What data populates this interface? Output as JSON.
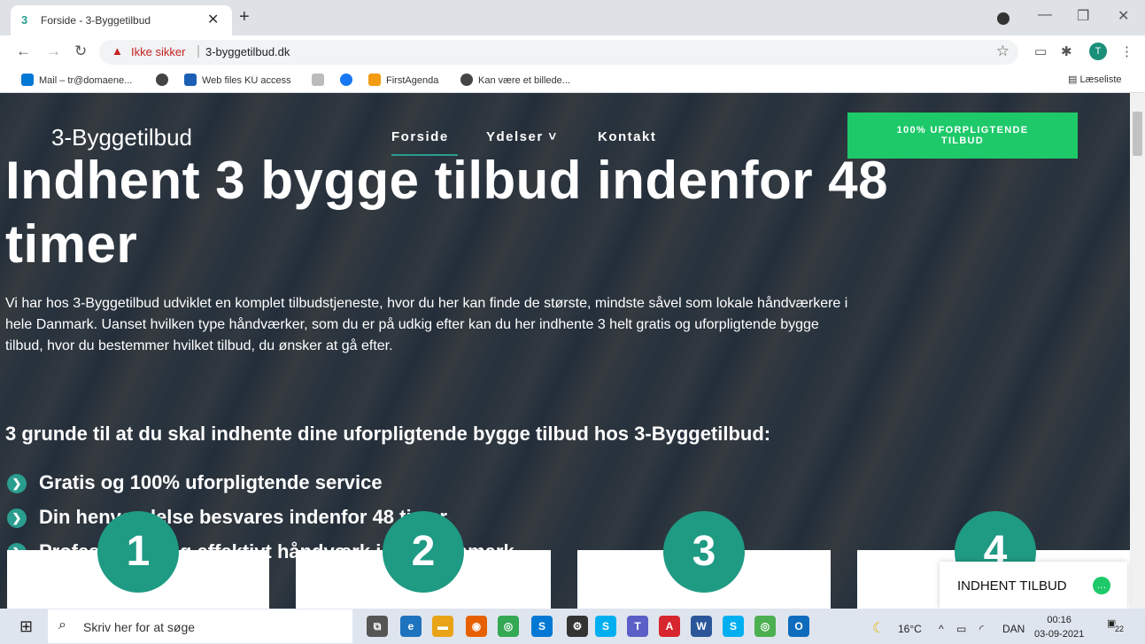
{
  "browser": {
    "tab_favicon": "3",
    "tab_title": "Forside - 3-Byggetilbud",
    "tab_close": "✕",
    "new_tab": "+",
    "security_label": "Ikke sikker",
    "url": "3-byggetilbud.dk",
    "bookmarks": [
      {
        "label": "Mail – tr@domaene...",
        "color": "#0078d4"
      },
      {
        "label": "",
        "color": "#444444"
      },
      {
        "label": "Web files KU access",
        "color": "#1a5fb4"
      },
      {
        "label": "",
        "color": "#888888"
      },
      {
        "label": "",
        "color": "#1877f2"
      },
      {
        "label": "FirstAgenda",
        "color": "#f39c12"
      },
      {
        "label": "Kan være et billede...",
        "color": "#444444"
      }
    ],
    "reading_list": "Læseliste",
    "avatar_letter": "T"
  },
  "site": {
    "logo": "3-Byggetilbud",
    "nav": [
      "Forside",
      "Ydelser ˅",
      "Kontakt"
    ],
    "cta": "100% UFORPLIGTENDE TILBUD",
    "hero_title": "Indhent 3 bygge tilbud indenfor 48 timer",
    "intro": "Vi har hos 3-Byggetilbud udviklet en komplet tilbudstjeneste, hvor du her kan finde de største, mindste såvel som lokale håndværkere i hele Danmark. Uanset hvilken type håndværker, som du er på udkig efter kan du her indhente 3 helt gratis og uforpligtende bygge tilbud, hvor du bestemmer hvilket tilbud, du ønsker at gå efter.",
    "reasons_title": "3 grunde til at du skal indhente dine uforpligtende bygge tilbud hos 3-Byggetilbud:",
    "reasons": [
      "Gratis og 100% uforpligtende service",
      "Din henvendelse besvares indenfor 48 timer",
      "Professionelt og effektivt håndværk i hele Danmark"
    ],
    "steps": [
      "1",
      "2",
      "3",
      "4"
    ],
    "chat_label": "INDHENT TILBUD",
    "accent": "#2a9d8f",
    "cta_color": "#1ec96a"
  },
  "taskbar": {
    "search_placeholder": "Skriv her for at søge",
    "apps": [
      {
        "name": "task-view",
        "color": "#555555",
        "glyph": "⧉"
      },
      {
        "name": "edge",
        "color": "#1e73be",
        "glyph": "e"
      },
      {
        "name": "explorer",
        "color": "#e8a317",
        "glyph": "▬"
      },
      {
        "name": "firefox",
        "color": "#e66000",
        "glyph": "◉"
      },
      {
        "name": "chrome",
        "color": "#34a853",
        "glyph": "◎"
      },
      {
        "name": "skype-business",
        "color": "#0078d4",
        "glyph": "S"
      },
      {
        "name": "settings",
        "color": "#333333",
        "glyph": "⚙"
      },
      {
        "name": "skype-alt",
        "color": "#00aff0",
        "glyph": "S"
      },
      {
        "name": "teams",
        "color": "#5b5fc7",
        "glyph": "T"
      },
      {
        "name": "acrobat",
        "color": "#d7262e",
        "glyph": "A"
      },
      {
        "name": "word",
        "color": "#2b579a",
        "glyph": "W"
      },
      {
        "name": "skype",
        "color": "#00aff0",
        "glyph": "S"
      },
      {
        "name": "chrome-alt",
        "color": "#4caf50",
        "glyph": "◎"
      },
      {
        "name": "outlook",
        "color": "#0f6cbd",
        "glyph": "O"
      }
    ],
    "temperature": "16°C",
    "language": "DAN",
    "time": "00:16",
    "date": "03-09-2021",
    "notifications": "22"
  }
}
